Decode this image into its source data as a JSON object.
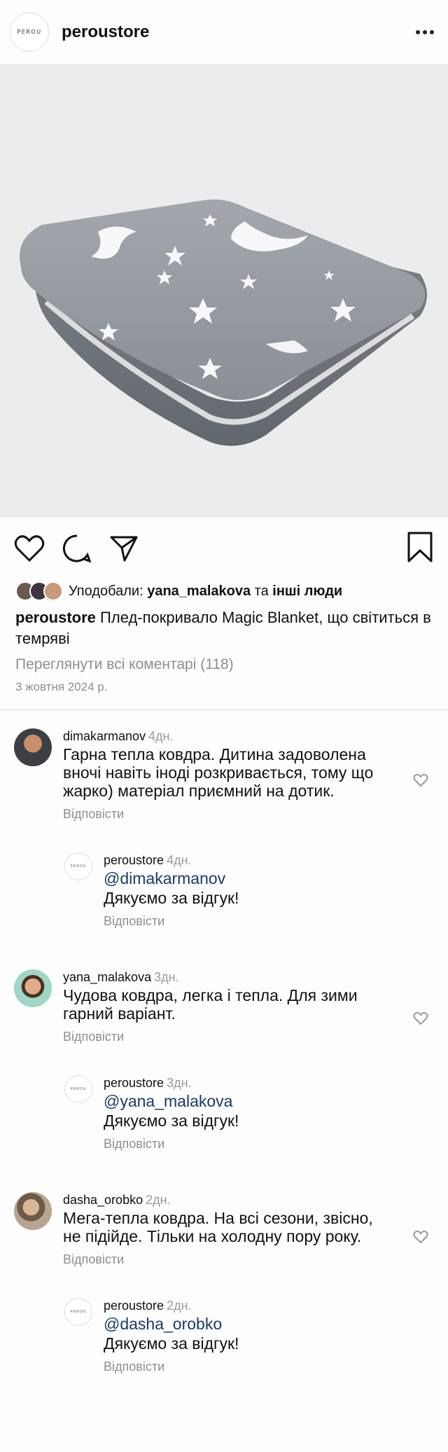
{
  "header": {
    "avatar_text": "PEROU",
    "username": "peroustore"
  },
  "icons": {
    "like": "heart-icon",
    "comment": "comment-bubble-icon",
    "share": "paper-plane-icon",
    "save": "bookmark-icon",
    "more": "more-dots-icon"
  },
  "likes": {
    "prefix": "Уподобали:",
    "user": "yana_malakova",
    "conjunction": "та",
    "others": "інші люди"
  },
  "caption": {
    "username": "peroustore",
    "text": "Плед-покривало Magic Blanket, що світиться в темряві"
  },
  "view_comments": "Переглянути всі коментарі (118)",
  "post_date": "3 жовтня 2024 р.",
  "comments": [
    {
      "username": "dimakarmanov",
      "ago": "4дн.",
      "text": "Гарна тепла ковдра. Дитина задоволена вночі навіть іноді розкривається, тому що жарко) матеріал приємний на дотик.",
      "reply_label": "Відповісти",
      "response": {
        "username": "peroustore",
        "ago": "4дн.",
        "mention": "@dimakarmanov",
        "text": "Дякуємо за відгук!",
        "reply_label": "Відповісти"
      }
    },
    {
      "username": "yana_malakova",
      "ago": "3дн.",
      "text": "Чудова ковдра, легка і тепла. Для зими гарний варіант.",
      "reply_label": "Відповісти",
      "response": {
        "username": "peroustore",
        "ago": "3дн.",
        "mention": "@yana_malakova",
        "text": "Дякуємо за відгук!",
        "reply_label": "Відповісти"
      }
    },
    {
      "username": "dasha_orobko",
      "ago": "2дн.",
      "text": "Мега-тепла ковдра. На всі сезони, звісно, не підійде. Тільки на холодну пору року.",
      "reply_label": "Відповісти",
      "response": {
        "username": "peroustore",
        "ago": "2дн.",
        "mention": "@dasha_orobko",
        "text": "Дякуємо за відгук!",
        "reply_label": "Відповісти"
      }
    }
  ]
}
